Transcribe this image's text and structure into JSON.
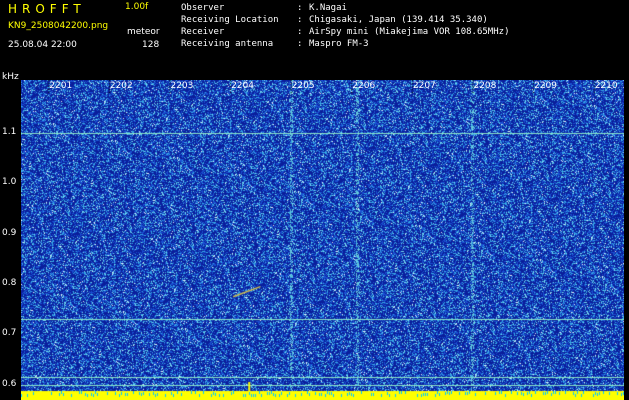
{
  "header": {
    "app_name": "HROFFT",
    "version": "1.00f",
    "filename": "KN9_2508042200.png",
    "mode": "meteor",
    "datetime": "25.08.04 22:00",
    "count": "128"
  },
  "metadata": [
    {
      "label": "Observer",
      "sep": ":",
      "value": "K.Nagai"
    },
    {
      "label": "Receiving Location",
      "sep": ":",
      "value": "Chigasaki, Japan (139.414 35.340)"
    },
    {
      "label": "Receiver",
      "sep": ":",
      "value": "AirSpy mini (Miakejima VOR 108.65MHz)"
    },
    {
      "label": "Receiving antenna",
      "sep": ":",
      "value": "Maspro FM-3"
    }
  ],
  "spectrogram": {
    "y_unit": "kHz",
    "y_ticks": [
      "1.1",
      "1.0",
      "0.9",
      "0.8",
      "0.7",
      "0.6"
    ],
    "y_tick_values": [
      1.1,
      1.0,
      0.9,
      0.8,
      0.7,
      0.6
    ],
    "y_range": [
      0.57,
      1.205
    ],
    "x_ticks": [
      "2201",
      "2202",
      "2203",
      "2204",
      "2205",
      "2206",
      "2207",
      "2208",
      "2209",
      "2210"
    ],
    "x_tick_minutes": [
      1,
      2,
      3,
      4,
      5,
      6,
      7,
      8,
      9,
      10
    ],
    "x_range_minutes": [
      0.55,
      10.5
    ],
    "colors": {
      "background": "#0a1e9b",
      "signal_low": "#1e5fd8",
      "signal_mid": "#3fb5e8",
      "signal_high": "#e8f0ff",
      "baseline": "#ffff00",
      "text_yellow": "#ffff00"
    }
  }
}
